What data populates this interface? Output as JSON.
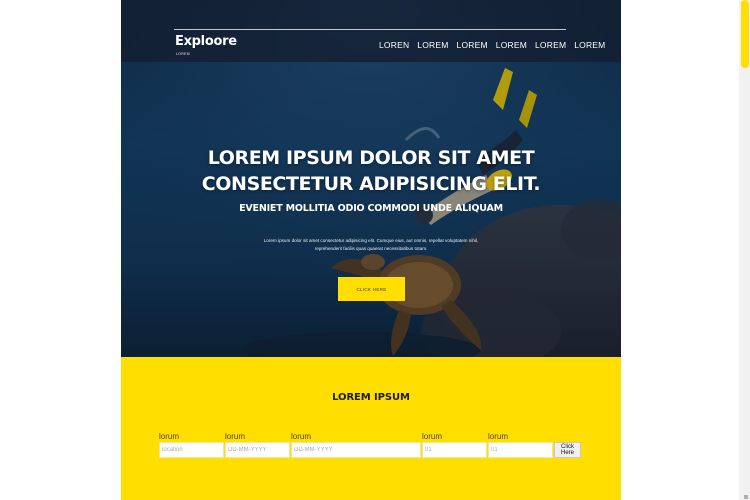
{
  "colors": {
    "accent": "#ffde00",
    "hero_water": "#134068",
    "navbar_bg": "#141c2c"
  },
  "header": {
    "logo": "Exploore",
    "logo_tagline": "LOREM",
    "nav": [
      "LOREN",
      "LOREM",
      "LOREM",
      "LOREM",
      "LOREM",
      "LOREM"
    ]
  },
  "hero": {
    "title": "LOREM IPSUM DOLOR SIT AMET CONSECTETUR ADIPISICING ELIT.",
    "subtitle": "EVENIET MOLLITIA ODIO COMMODI UNDE ALIQUAM",
    "text": "Lorem ipsum dolor sit amet consectetur adipisicing elit. Cumque eius, aut omnis, repellat voluptatem nihil, reprehenderit facilis quas quaerat necessitatibus totam.",
    "button_label": "CLICK HERE"
  },
  "booking": {
    "title": "LOREM IPSUM",
    "fields": [
      {
        "label": "lorum",
        "placeholder": "location"
      },
      {
        "label": "lorum",
        "placeholder": "DD-MM-YYYY"
      },
      {
        "label": "lorum",
        "placeholder": "DD-MM-YYYY"
      },
      {
        "label": "lorum",
        "placeholder": "01"
      },
      {
        "label": "lorum",
        "placeholder": "01"
      }
    ],
    "button_label": "Click Here"
  }
}
